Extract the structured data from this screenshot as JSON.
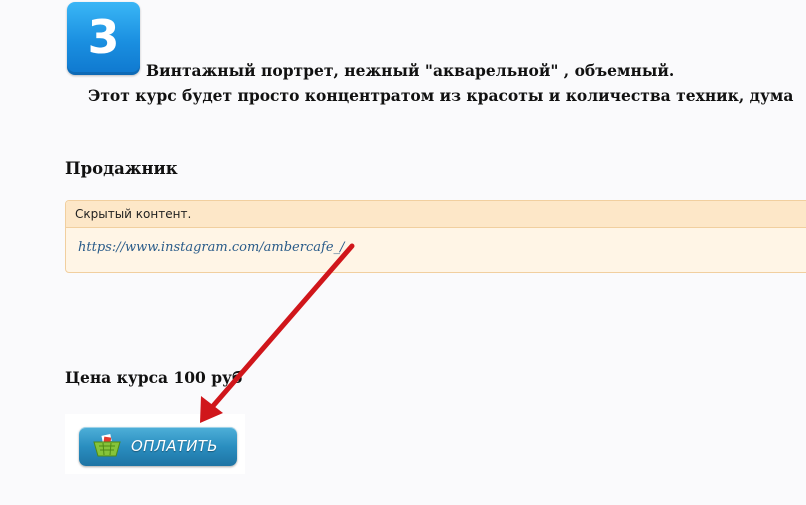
{
  "post": {
    "badge_number": "3",
    "line1": "Винтажный портрет, нежный \"акварельной\" , объемный.",
    "line2": "Этот курс будет просто концентратом из красоты и количества техник, дума",
    "seller_heading": "Продажник",
    "hidden_content": {
      "header": "Скрытый контент.",
      "link": "https://www.instagram.com/ambercafe_/"
    },
    "price_heading": "Цена курса 100 руб",
    "pay_button_label": "ОПЛАТИТЬ"
  },
  "colors": {
    "badge_blue": "#1a8fe0",
    "hidden_box_bg": "#fff5e6",
    "hidden_box_border": "#f1cf9f",
    "link": "#2a5c8a",
    "pay_button": "#2a8ec0",
    "arrow": "#d0161b"
  },
  "icons": {
    "badge": "number-3-icon",
    "cart": "shopping-cart-icon",
    "arrow": "red-arrow-annotation"
  }
}
